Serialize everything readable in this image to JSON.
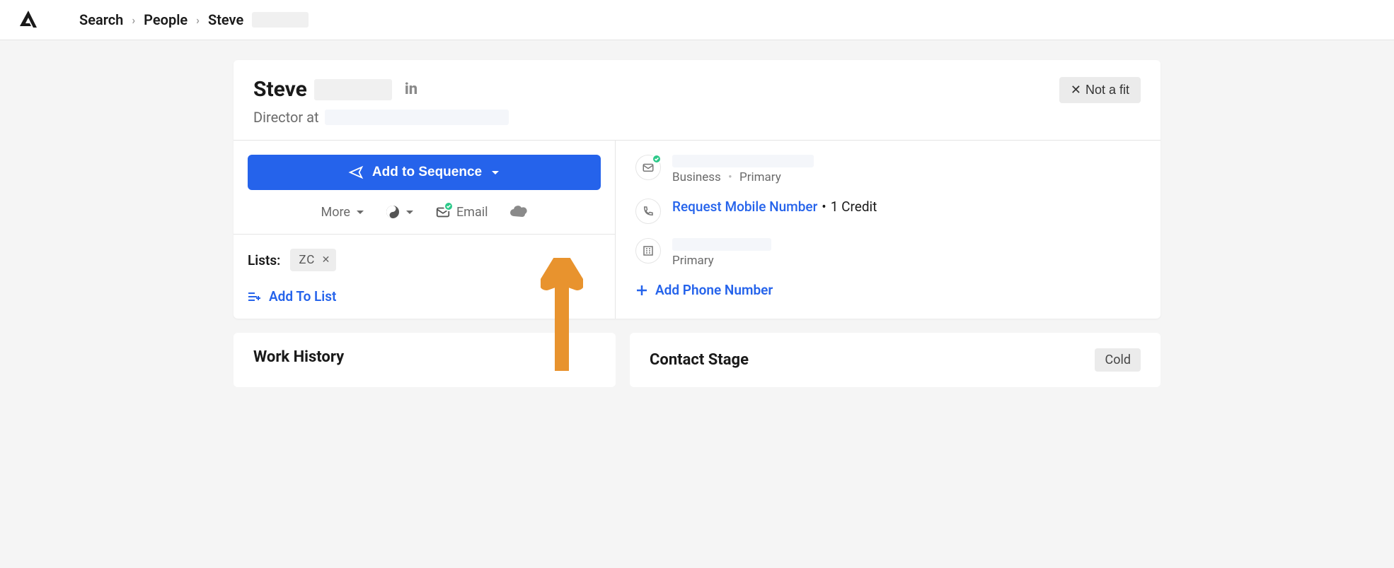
{
  "breadcrumb": {
    "level1": "Search",
    "level2": "People",
    "level3": "Steve"
  },
  "person": {
    "first_name": "Steve",
    "role_prefix": "Director at"
  },
  "buttons": {
    "not_fit": "Not a fit",
    "add_sequence": "Add to Sequence",
    "more": "More",
    "email": "Email"
  },
  "lists": {
    "label": "Lists:",
    "chip": "ZC",
    "add_link": "Add To List"
  },
  "contact": {
    "email_tags": {
      "business": "Business",
      "primary": "Primary"
    },
    "request_mobile": "Request Mobile Number",
    "credit": "1 Credit",
    "company_primary": "Primary",
    "add_phone": "Add Phone Number"
  },
  "sections": {
    "work_history": "Work History",
    "contact_stage": "Contact Stage",
    "stage_value": "Cold"
  }
}
